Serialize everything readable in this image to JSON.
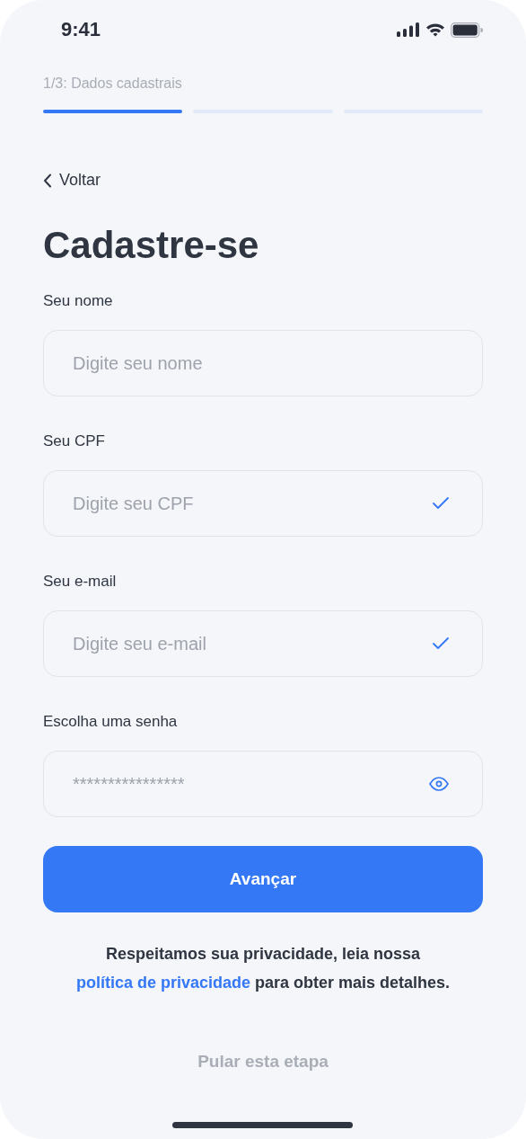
{
  "status_bar": {
    "time": "9:41"
  },
  "progress": {
    "label": "1/3: Dados cadastrais",
    "steps": [
      {
        "active": true
      },
      {
        "active": false
      },
      {
        "active": false
      }
    ]
  },
  "back": {
    "label": "Voltar"
  },
  "title": "Cadastre-se",
  "fields": [
    {
      "label": "Seu nome",
      "placeholder": "Digite seu nome",
      "kind": "plain"
    },
    {
      "label": "Seu CPF",
      "placeholder": "Digite seu CPF",
      "kind": "valid"
    },
    {
      "label": "Seu e-mail",
      "placeholder": "Digite seu e-mail",
      "kind": "valid"
    },
    {
      "label": "Escolha uma senha",
      "placeholder": "****************",
      "kind": "password"
    }
  ],
  "submit": {
    "label": "Avançar"
  },
  "privacy": {
    "before": "Respeitamos sua privacidade, leia nossa ",
    "link": "política de privacidade",
    "after": " para obter mais detalhes."
  },
  "skip": {
    "label": "Pular esta etapa"
  }
}
